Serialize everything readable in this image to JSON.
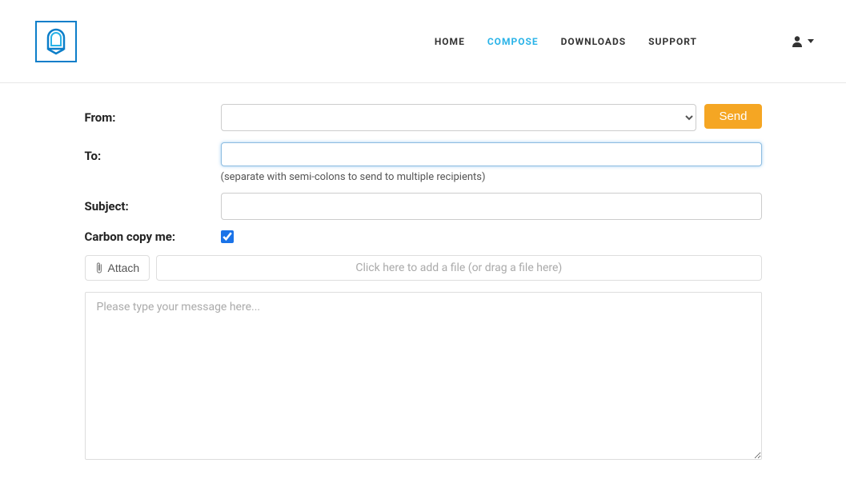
{
  "nav": {
    "home": "HOME",
    "compose": "COMPOSE",
    "downloads": "DOWNLOADS",
    "support": "SUPPORT"
  },
  "form": {
    "from_label": "From:",
    "to_label": "To:",
    "subject_label": "Subject:",
    "cc_label": "Carbon copy me:",
    "send_label": "Send",
    "attach_label": "Attach",
    "to_helper": "(separate with semi-colons to send to multiple recipients)",
    "dropzone_text": "Click here to add a file (or drag a file here)",
    "message_placeholder": "Please type your message here...",
    "from_value": "",
    "to_value": "",
    "subject_value": "",
    "cc_checked": true
  },
  "colors": {
    "accent": "#29b3e8",
    "send_button": "#f5a623",
    "brand": "#0c7ec9"
  }
}
